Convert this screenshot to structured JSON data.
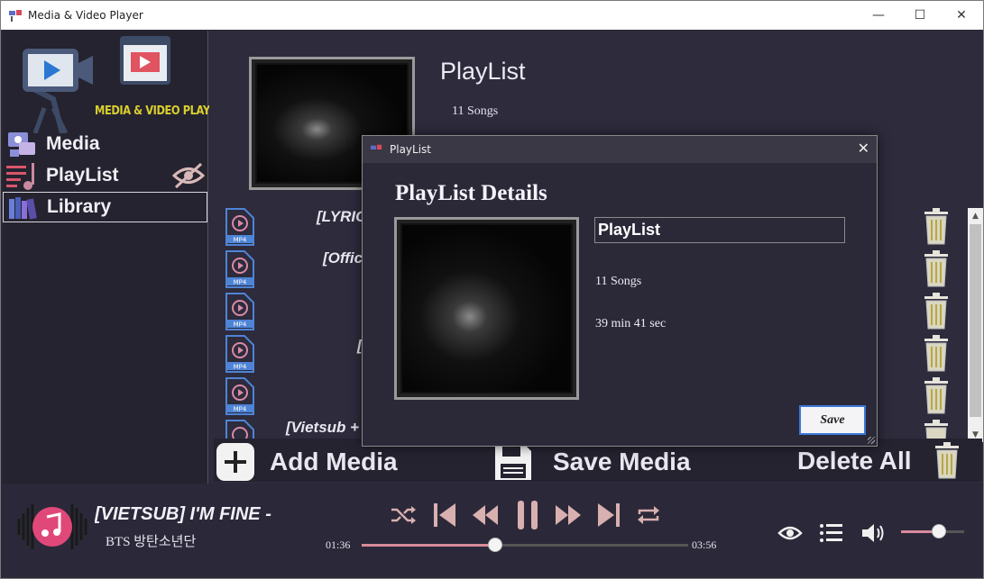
{
  "window": {
    "title": "Media & Video Player",
    "controls": [
      "minimize-icon",
      "maximize-icon",
      "close-icon"
    ]
  },
  "sidebar": {
    "logo_text": "MEDIA & VIDEO PLAYER",
    "items": [
      {
        "label": "Media",
        "icon": "media-icon"
      },
      {
        "label": "PlayList",
        "icon": "playlist-icon"
      },
      {
        "label": "Library",
        "icon": "library-icon",
        "selected": true
      }
    ]
  },
  "main": {
    "playlist_title": "PlayList",
    "song_count": "11 Songs",
    "tracks": [
      "[LYRIC",
      "[Offic",
      "[",
      "[Vietsub +"
    ]
  },
  "actions": {
    "add": "Add Media",
    "save": "Save Media",
    "delete": "Delete All"
  },
  "player": {
    "title": "[VIETSUB] I'M FINE -",
    "artist": "BTS 방탄소년단",
    "current_time": "01:36",
    "total_time": "03:56",
    "progress_fraction": 0.41,
    "volume_fraction": 0.6
  },
  "dialog": {
    "title": "PlayList",
    "heading": "PlayList Details",
    "name_value": "PlayList",
    "song_count": "11 Songs",
    "duration": "39 min 41 sec",
    "save_label": "Save"
  },
  "colors": {
    "accent": "#d98a9a",
    "sidebar_bg": "#25232f",
    "main_bg": "#2d2b3c",
    "logo_text": "#d9cf2f"
  }
}
